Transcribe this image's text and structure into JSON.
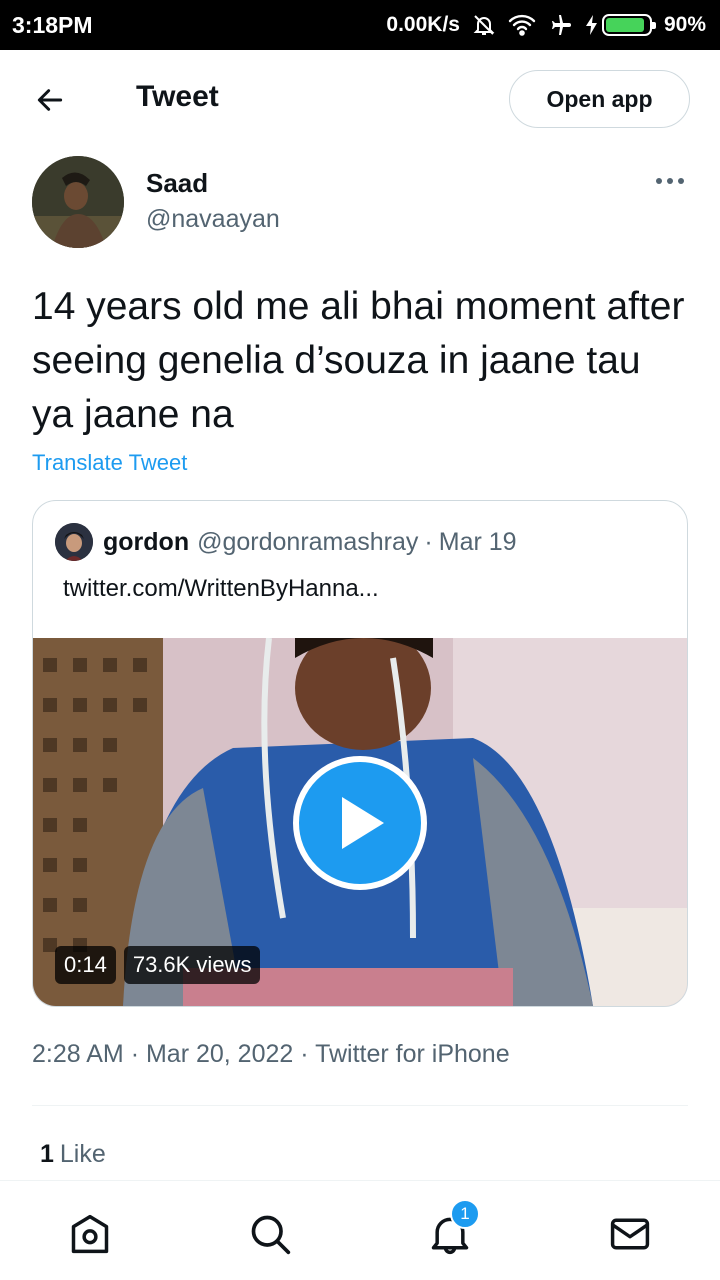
{
  "status_bar": {
    "time": "3:18PM",
    "network_speed": "0.00K/s",
    "battery_percent": "90%",
    "battery_level": 0.9,
    "icons": [
      "alarm-off-icon",
      "wifi-icon",
      "airplane-icon",
      "charging-icon",
      "battery-icon"
    ]
  },
  "app_bar": {
    "title": "Tweet",
    "back_icon": "back-arrow-icon",
    "open_app_label": "Open app"
  },
  "tweet": {
    "author_name": "Saad",
    "author_handle": "@navaayan",
    "text": "14 years old me ali bhai moment after seeing genelia d’souza in jaane tau ya jaane na",
    "translate_label": "Translate Tweet",
    "time": "2:28 AM",
    "date": "Mar 20, 2022",
    "source": "Twitter for iPhone",
    "sep": "·",
    "likes_count": "1",
    "likes_label": "Like"
  },
  "quote": {
    "author_name": "gordon",
    "author_handle": "@gordonramashray",
    "sep": "·",
    "date": "Mar 19",
    "link_text": "twitter.com/WrittenByHanna...",
    "video": {
      "duration": "0:14",
      "views": "73.6K views"
    }
  },
  "bottom_nav": {
    "items": [
      "home-icon",
      "search-icon",
      "notifications-icon",
      "messages-icon"
    ],
    "notifications_badge": "1"
  },
  "colors": {
    "accent": "#1d9bf0",
    "text_primary": "#0f1419",
    "text_secondary": "#536471",
    "border": "#cfd9de"
  }
}
